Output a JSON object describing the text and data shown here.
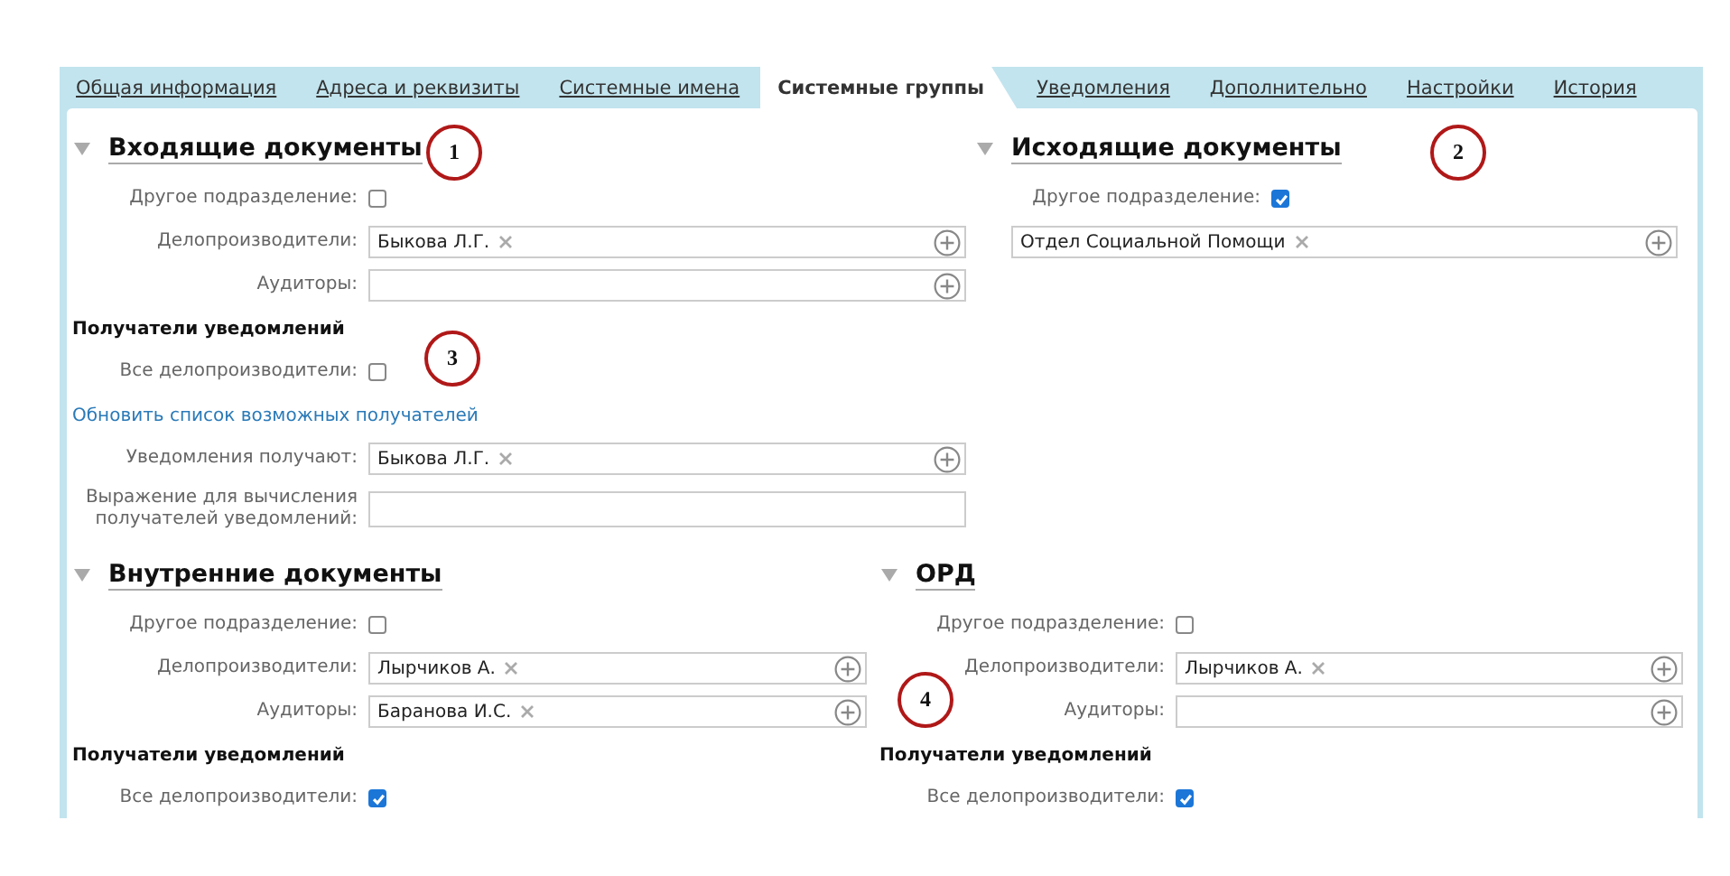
{
  "tabs": [
    {
      "label": "Общая информация",
      "selected": false
    },
    {
      "label": "Адреса и реквизиты",
      "selected": false
    },
    {
      "label": "Системные имена",
      "selected": false
    },
    {
      "label": "Системные группы",
      "selected": true
    },
    {
      "label": "Уведомления",
      "selected": false
    },
    {
      "label": "Дополнительно",
      "selected": false
    },
    {
      "label": "Настройки",
      "selected": false
    },
    {
      "label": "История",
      "selected": false
    }
  ],
  "section_rows": [
    {
      "sections": [
        {
          "title": "Входящие документы",
          "expanded": true,
          "rows": [
            {
              "kind": "checkbox",
              "label": "Другое подразделение:",
              "checked": false
            },
            {
              "kind": "picker",
              "label": "Делопроизводители:",
              "tags": [
                "Быкова Л.Г."
              ]
            },
            {
              "kind": "picker",
              "label": "Аудиторы:"
            },
            {
              "kind": "heading",
              "label": "Получатели уведомлений"
            },
            {
              "kind": "checkbox",
              "label": "Все делопроизводители:",
              "checked": false
            },
            {
              "kind": "link",
              "label": "Обновить список возможных получателей"
            },
            {
              "kind": "picker",
              "label": "Уведомления получают:",
              "tags": [
                "Быкова Л.Г."
              ]
            },
            {
              "kind": "text",
              "label": "Выражение для вычисления получателей уведомлений:"
            }
          ]
        },
        {
          "title": "Исходящие документы",
          "expanded": true,
          "rows": [
            {
              "kind": "checkbox",
              "label": "Другое подразделение:",
              "checked": true
            },
            {
              "kind": "picker",
              "tags": [
                "Отдел Социальной Помощи"
              ]
            }
          ]
        }
      ]
    },
    {
      "sections": [
        {
          "title": "Внутренние документы",
          "expanded": true,
          "rows": [
            {
              "kind": "checkbox",
              "label": "Другое подразделение:",
              "checked": false
            },
            {
              "kind": "picker",
              "label": "Делопроизводители:",
              "tags": [
                "Лырчиков А."
              ]
            },
            {
              "kind": "picker",
              "label": "Аудиторы:",
              "tags": [
                "Баранова И.С."
              ]
            },
            {
              "kind": "heading",
              "label": "Получатели уведомлений"
            },
            {
              "kind": "checkbox",
              "label": "Все делопроизводители:",
              "checked": true
            }
          ]
        },
        {
          "title": "ОРД",
          "expanded": true,
          "rows": [
            {
              "kind": "checkbox",
              "label": "Другое подразделение:",
              "checked": false
            },
            {
              "kind": "picker",
              "label": "Делопроизводители:",
              "tags": [
                "Лырчиков А."
              ]
            },
            {
              "kind": "picker",
              "label": "Аудиторы:"
            },
            {
              "kind": "heading",
              "label": "Получатели уведомлений"
            },
            {
              "kind": "checkbox",
              "label": "Все делопроизводители:",
              "checked": true
            }
          ]
        }
      ]
    }
  ],
  "callouts": [
    {
      "label": "1"
    },
    {
      "label": "2"
    },
    {
      "label": "3"
    },
    {
      "label": "4"
    }
  ]
}
